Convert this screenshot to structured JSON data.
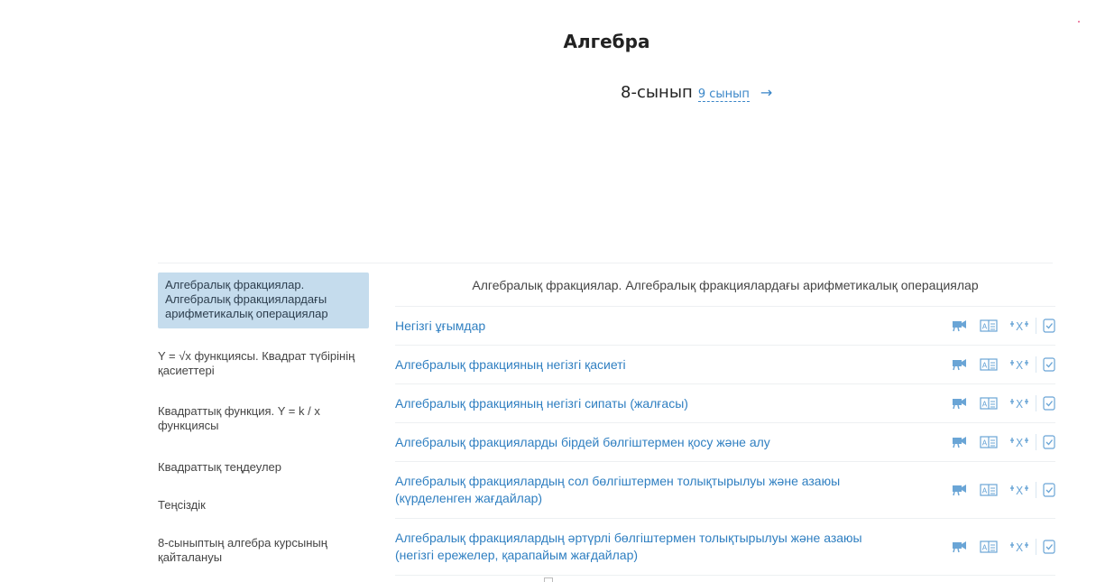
{
  "header": {
    "title": "Алгебра",
    "current_grade": "8-сынып",
    "next_grade_link": "9 сынып",
    "next_arrow": "→"
  },
  "sidebar": {
    "items": [
      {
        "label": "Алгебралық фракциялар. Алгебралық фракциялардағы арифметикалық операциялар",
        "active": true
      },
      {
        "label": "Y = √x функциясы. Квадрат түбірінің қасиеттері",
        "active": false
      },
      {
        "label": "Квадраттық функция. Y = k / x функциясы",
        "active": false
      },
      {
        "label": "Квадраттық теңдеулер",
        "active": false
      },
      {
        "label": "Теңсіздік",
        "active": false
      },
      {
        "label": "8-сыныптың алгебра курсының қайталануы",
        "active": false
      }
    ]
  },
  "main": {
    "section_title": "Алгебралық фракциялар. Алгебралық фракциялардағы арифметикалық операциялар",
    "lessons": [
      {
        "label": "Негізгі ұғымдар"
      },
      {
        "label": "Алгебралық фракцияның негізгі қасиеті"
      },
      {
        "label": "Алгебралық фракцияның негізгі сипаты (жалғасы)"
      },
      {
        "label": "Алгебралық фракцияларды бірдей бөлгіштермен қосу және алу"
      },
      {
        "label": "Алгебралық фракциялардың сол бөлгіштермен толықтырылуы және азаюы (күрделенген жағдайлар)"
      },
      {
        "label": "Алгебралық фракциялардың әртүрлі бөлгіштермен толықтырылуы және азаюы (негізгі ережелер, қарапайым жағдайлар)"
      }
    ],
    "row_icons": [
      "video-icon",
      "reading-icon",
      "trainer-icon",
      "test-icon"
    ]
  },
  "colors": {
    "accent": "#2f7fc1",
    "active_bg": "#c5dced",
    "icon_blue": "#6aa5d6"
  }
}
